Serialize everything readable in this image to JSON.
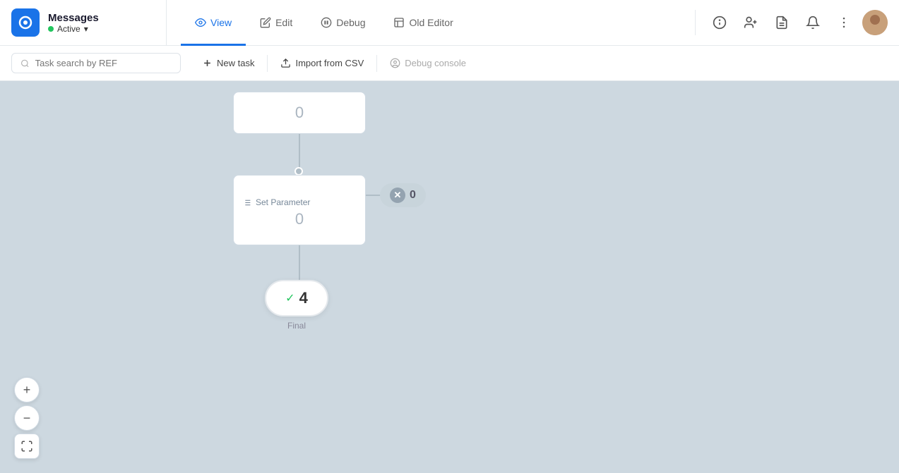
{
  "app": {
    "name": "Messages",
    "status": "Active"
  },
  "nav": {
    "tabs": [
      {
        "id": "view",
        "label": "View",
        "active": true
      },
      {
        "id": "edit",
        "label": "Edit",
        "active": false
      },
      {
        "id": "debug",
        "label": "Debug",
        "active": false
      },
      {
        "id": "old-editor",
        "label": "Old Editor",
        "active": false
      }
    ]
  },
  "toolbar": {
    "search_placeholder": "Task search by REF",
    "new_task_label": "New task",
    "import_label": "Import from CSV",
    "debug_label": "Debug console"
  },
  "canvas": {
    "nodes": [
      {
        "id": "top-node",
        "value": "0"
      },
      {
        "id": "set-param",
        "label": "Set Parameter",
        "value": "0"
      },
      {
        "id": "final",
        "value": "4",
        "label": "Final"
      }
    ],
    "error_badge": {
      "count": "0"
    }
  },
  "zoom": {
    "plus_label": "+",
    "minus_label": "−"
  }
}
